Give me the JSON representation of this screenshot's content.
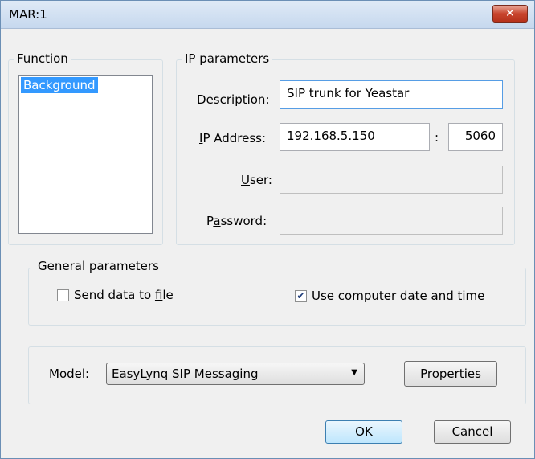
{
  "window": {
    "title": "MAR:1",
    "close_glyph": "✕"
  },
  "function_group": {
    "legend": "Function",
    "items": [
      "Background"
    ]
  },
  "ip_group": {
    "legend": "IP parameters",
    "description_label": "Description:",
    "description_value": "SIP trunk for Yeastar",
    "ip_label": "IP Address:",
    "ip_value": "192.168.5.150",
    "port_sep": ":",
    "port_value": "5060",
    "user_label": "User:",
    "user_value": "",
    "password_label": "Password:",
    "password_value": ""
  },
  "general_group": {
    "legend": "General parameters",
    "send_file_label": "Send data to file",
    "send_file_checked": false,
    "use_time_label": "Use computer date and time",
    "use_time_checked": true
  },
  "model_group": {
    "label": "Model:",
    "selected": "EasyLynq SIP Messaging",
    "properties_label": "Properties"
  },
  "buttons": {
    "ok": "OK",
    "cancel": "Cancel"
  }
}
